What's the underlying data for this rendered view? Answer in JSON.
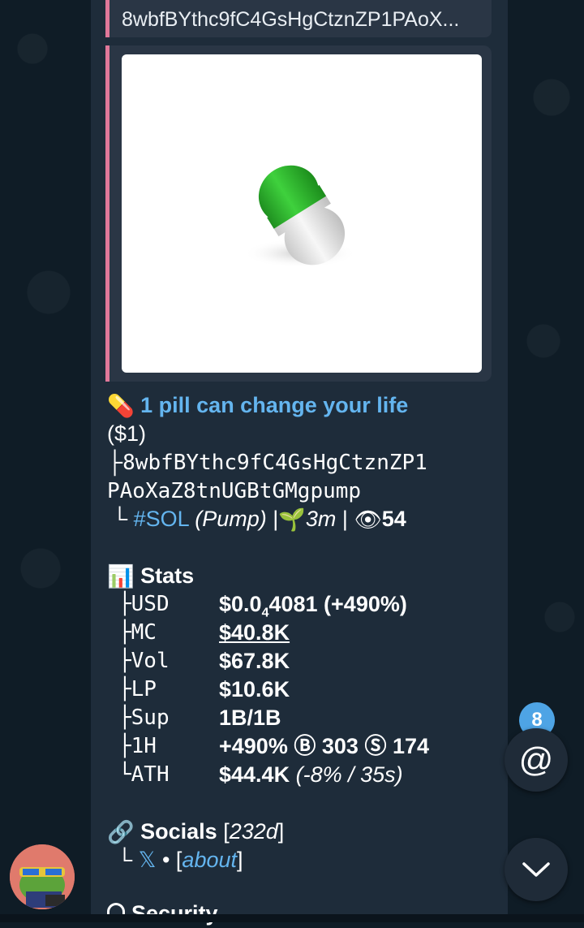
{
  "reply": {
    "text": "8wbfBYthc9fC4GsHgCtznZP1PAoX..."
  },
  "media": {
    "alt_icon": "green-white-pill-image"
  },
  "token": {
    "emoji": "💊",
    "name": "1 pill can change your life",
    "price_tag": "($1)",
    "tree_branch": "├",
    "tree_end": "└",
    "address_line1": "8wbfBYthc9fC4GsHgCtznZP1",
    "address_line2": "PAoXaZ8tnUGBtGMgpump",
    "chain_tag": "#SOL",
    "platform": "(Pump)",
    "sep": "|",
    "age_emoji": "🌱",
    "age": "3m",
    "views_emoji": "👁",
    "views": "54"
  },
  "stats": {
    "emoji": "📊",
    "heading": "Stats",
    "rows": [
      {
        "branch": "├",
        "key": "USD",
        "value_pre": "$0.0",
        "value_sub": "4",
        "value_post": "4081",
        "extra": " (+490%)"
      },
      {
        "branch": "├",
        "key": "MC",
        "value": "$40.8K"
      },
      {
        "branch": "├",
        "key": "Vol",
        "value": "$67.8K"
      },
      {
        "branch": "├",
        "key": "LP",
        "value": "$10.6K"
      },
      {
        "branch": "├",
        "key": "Sup",
        "value": "1B/1B"
      },
      {
        "branch": "├",
        "key": "1H",
        "value": "+490%",
        "buy_icon": "Ⓑ",
        "buys": "303",
        "sell_icon": "Ⓢ",
        "sells": "174"
      },
      {
        "branch": "└",
        "key": "ATH",
        "value": "$44.4K",
        "extra": "(-8% / 35s)"
      }
    ]
  },
  "socials": {
    "emoji": "🔗",
    "heading": "Socials",
    "age_open": " [",
    "age": "232d",
    "age_close": "]",
    "branch": "└",
    "x_label": "𝕏",
    "bullet": "•",
    "about_open": "[",
    "about": "about",
    "about_close": "]"
  },
  "security": {
    "heading_partial": "Security"
  },
  "mentions": {
    "count": "8",
    "icon": "@"
  },
  "colors": {
    "accent": "#64b5ef",
    "quote_bar": "#e0789a",
    "bubble": "#1e2c3a"
  }
}
